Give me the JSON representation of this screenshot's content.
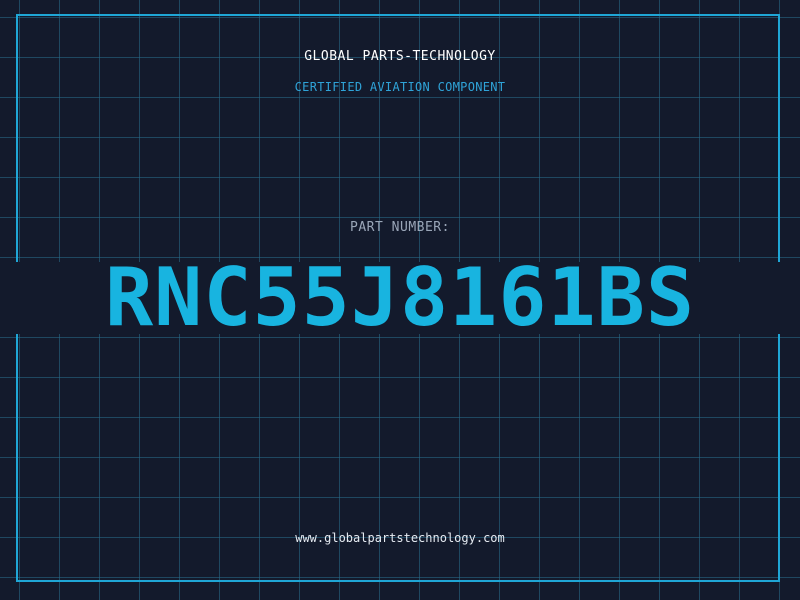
{
  "header": {
    "company": "GLOBAL PARTS-TECHNOLOGY",
    "tagline": "CERTIFIED AVIATION COMPONENT"
  },
  "part": {
    "label": "PART NUMBER:",
    "number": "RNC55J8161BS"
  },
  "footer": {
    "website": "www.globalpartstechnology.com"
  },
  "colors": {
    "background": "#131a2c",
    "grid": "#286e8c",
    "frame": "#1fa6d6",
    "accent": "#18b4e0",
    "label": "#9aa6b8",
    "text": "#ffffff"
  }
}
